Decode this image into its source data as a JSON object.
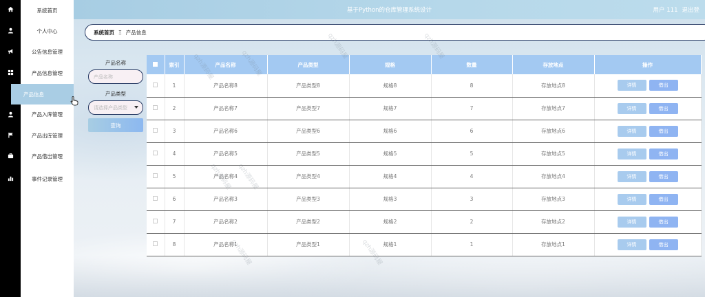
{
  "app_title": "基于Python的仓库管理系统设计",
  "user": {
    "label": "用户 111",
    "logout": "退出登"
  },
  "sidebar": {
    "items": [
      {
        "label": "系统首页",
        "icon": "home-icon"
      },
      {
        "label": "个人中心",
        "icon": "user-icon"
      },
      {
        "label": "公告信息管理",
        "icon": "megaphone-icon"
      },
      {
        "label": "产品信息管理",
        "icon": "grid-icon"
      },
      {
        "label": "产品信息",
        "icon": "",
        "active": true
      },
      {
        "label": "产品入库管理",
        "icon": "user-icon"
      },
      {
        "label": "产品出库管理",
        "icon": "flag-icon"
      },
      {
        "label": "产品借出管理",
        "icon": "briefcase-icon"
      },
      {
        "label": "事件记录管理",
        "icon": "bar-chart-icon"
      }
    ]
  },
  "breadcrumb": {
    "home": "系统首页",
    "separator": "Ξ",
    "current": "产品信息"
  },
  "search": {
    "name_label": "产品名称",
    "name_placeholder": "产品名称",
    "type_label": "产品类型",
    "type_placeholder": "请选择产品类型",
    "button": "查询"
  },
  "table": {
    "columns": [
      "索引",
      "产品名称",
      "产品类型",
      "规格",
      "数量",
      "存放地点",
      "操作"
    ],
    "rows": [
      {
        "index": "1",
        "name": "产品名称8",
        "type": "产品类型8",
        "spec": "规格8",
        "qty": "8",
        "location": "存放地点8"
      },
      {
        "index": "2",
        "name": "产品名称7",
        "type": "产品类型7",
        "spec": "规格7",
        "qty": "7",
        "location": "存放地点7"
      },
      {
        "index": "3",
        "name": "产品名称6",
        "type": "产品类型6",
        "spec": "规格6",
        "qty": "6",
        "location": "存放地点6"
      },
      {
        "index": "4",
        "name": "产品名称5",
        "type": "产品类型5",
        "spec": "规格5",
        "qty": "5",
        "location": "存放地点5"
      },
      {
        "index": "5",
        "name": "产品名称4",
        "type": "产品类型4",
        "spec": "规格4",
        "qty": "4",
        "location": "存放地点4"
      },
      {
        "index": "6",
        "name": "产品名称3",
        "type": "产品类型3",
        "spec": "规格3",
        "qty": "3",
        "location": "存放地点3"
      },
      {
        "index": "7",
        "name": "产品名称2",
        "type": "产品类型2",
        "spec": "规格2",
        "qty": "2",
        "location": "存放地点2"
      },
      {
        "index": "8",
        "name": "产品名称1",
        "type": "产品类型1",
        "spec": "规格1",
        "qty": "1",
        "location": "存放地点1"
      }
    ],
    "detail_label": "详情",
    "borrow_label": "借出"
  },
  "watermark": "qzh源码屋"
}
